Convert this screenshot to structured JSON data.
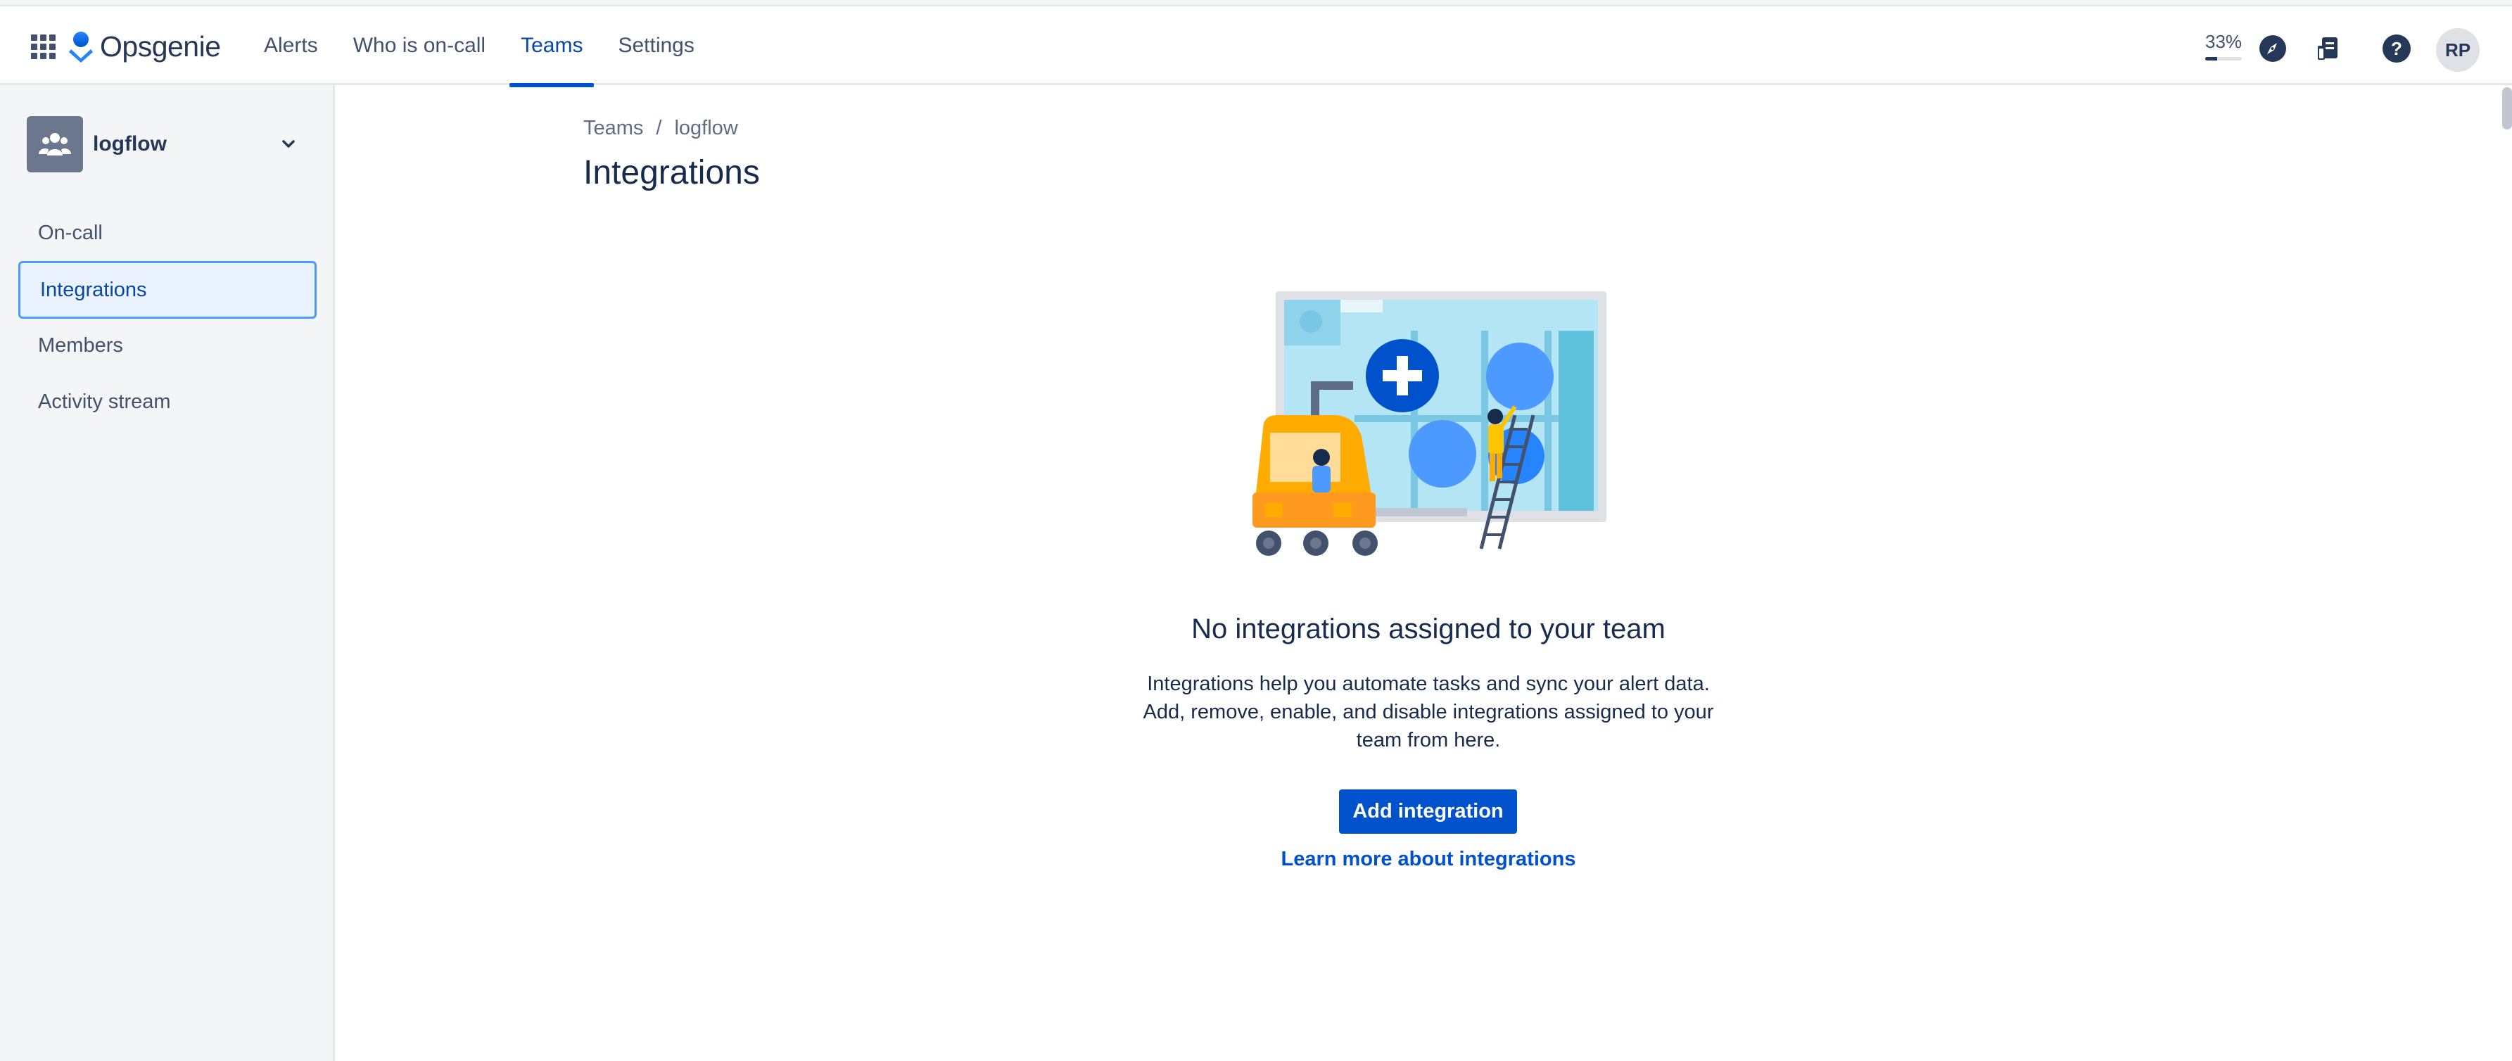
{
  "header": {
    "logo_text": "Opsgenie",
    "nav": [
      {
        "label": "Alerts"
      },
      {
        "label": "Who is on-call"
      },
      {
        "label": "Teams"
      },
      {
        "label": "Settings"
      }
    ],
    "active_nav": "Teams",
    "progress_label": "33%",
    "progress_value": 0.33,
    "avatar_initials": "RP"
  },
  "sidebar": {
    "team_name": "logflow",
    "items": [
      {
        "label": "On-call"
      },
      {
        "label": "Integrations"
      },
      {
        "label": "Members"
      },
      {
        "label": "Activity stream"
      }
    ],
    "active_item": "Integrations"
  },
  "main": {
    "breadcrumb": [
      "Teams",
      "logflow"
    ],
    "breadcrumb_separator": "/",
    "title": "Integrations",
    "empty_title": "No integrations assigned to your team",
    "empty_description": "Integrations help you automate tasks and sync your alert data. Add, remove, enable, and disable integrations assigned to your team from here.",
    "add_button": "Add integration",
    "learn_link": "Learn more about integrations"
  },
  "colors": {
    "brand_blue": "#0052cc",
    "text_dark": "#172b4d",
    "sidebar_bg": "#f4f5f7"
  }
}
